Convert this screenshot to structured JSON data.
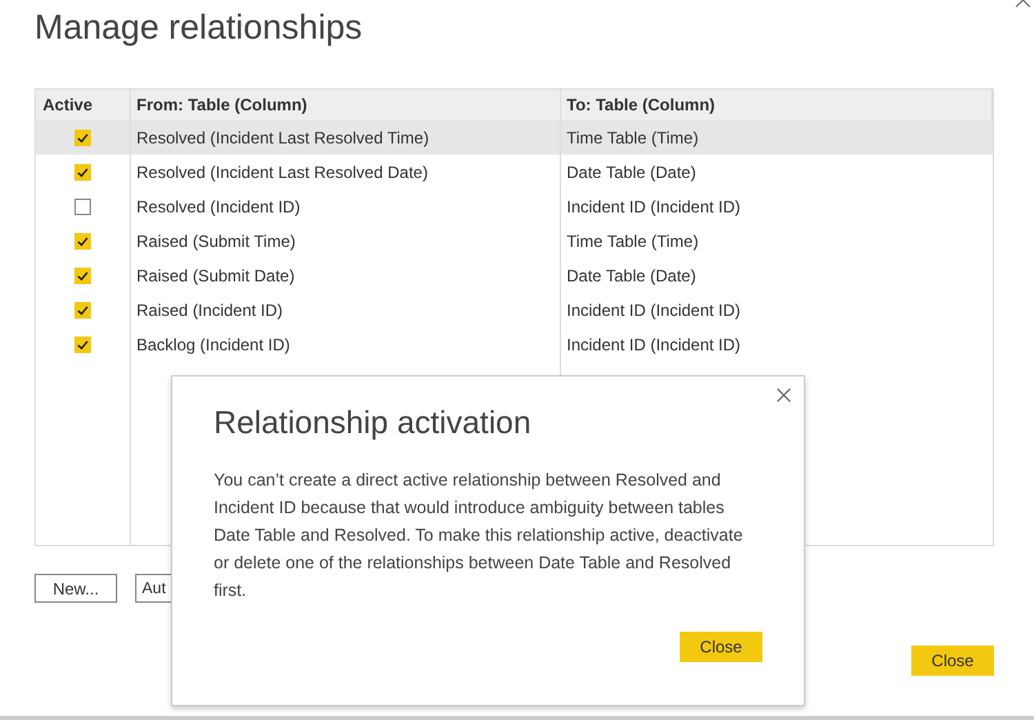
{
  "window": {
    "title": "Manage relationships"
  },
  "table": {
    "columns": [
      "Active",
      "From: Table (Column)",
      "To: Table (Column)"
    ],
    "rows": [
      {
        "active": true,
        "from": "Resolved (Incident Last Resolved Time)",
        "to": "Time Table (Time)",
        "selected": true
      },
      {
        "active": true,
        "from": "Resolved (Incident Last Resolved Date)",
        "to": "Date Table (Date)",
        "selected": false
      },
      {
        "active": false,
        "from": "Resolved (Incident ID)",
        "to": "Incident ID (Incident ID)",
        "selected": false
      },
      {
        "active": true,
        "from": "Raised (Submit Time)",
        "to": "Time Table (Time)",
        "selected": false
      },
      {
        "active": true,
        "from": "Raised (Submit Date)",
        "to": "Date Table (Date)",
        "selected": false
      },
      {
        "active": true,
        "from": "Raised (Incident ID)",
        "to": "Incident ID (Incident ID)",
        "selected": false
      },
      {
        "active": true,
        "from": "Backlog (Incident ID)",
        "to": "Incident ID (Incident ID)",
        "selected": false
      }
    ]
  },
  "buttons": [
    "New...",
    "Aut"
  ],
  "close_button": "Close",
  "dialog": {
    "title": "Relationship activation",
    "message": "You can’t create a direct active relationship between Resolved and Incident ID because that would introduce ambiguity between tables Date Table and Resolved. To make this relationship active, deactivate or delete one of the relationships between Date Table and Resolved first.",
    "close_button": "Close"
  }
}
